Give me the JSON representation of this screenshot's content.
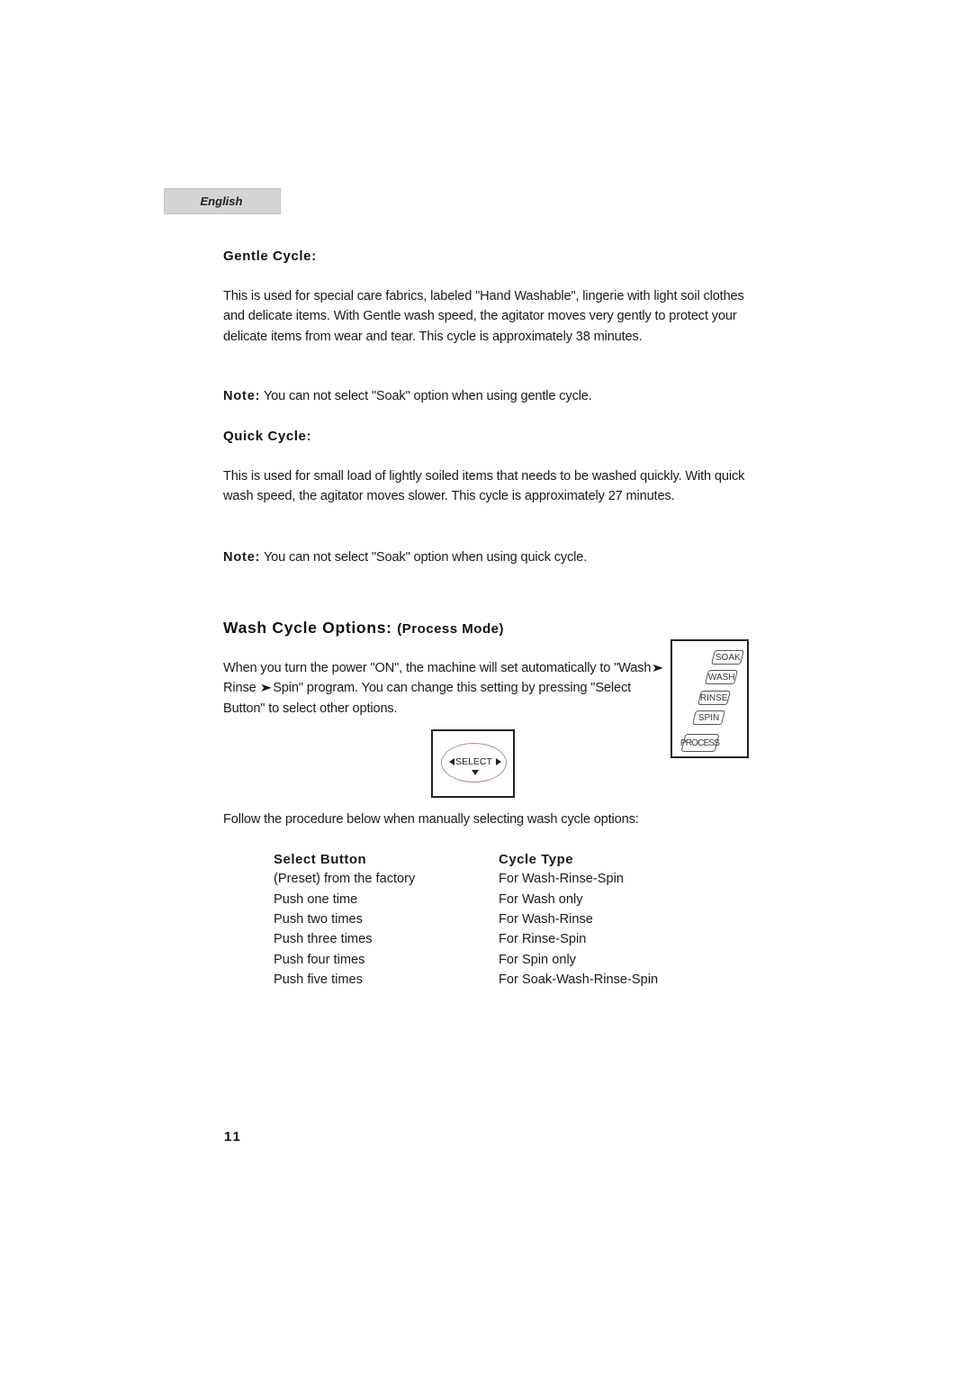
{
  "language_tab": "English",
  "gentle": {
    "heading": "Gentle Cycle:",
    "text": "This is used for special care fabrics, labeled \"Hand Washable\", lingerie with light soil clothes and delicate items. With Gentle wash speed, the agitator moves very gently to protect your delicate items from wear and tear. This cycle is approximately 38 minutes.",
    "note_label": "Note:",
    "note_text": " You can not select \"Soak\" option when using gentle cycle."
  },
  "quick": {
    "heading": "Quick Cycle:",
    "text": "This is used for small load of lightly soiled items that needs to be washed quickly. With quick wash speed, the agitator moves slower. This cycle is approximately 27 minutes.",
    "note_label": "Note:",
    "note_text": " You can not select \"Soak\" option when using quick cycle."
  },
  "wash_options": {
    "heading": "Wash Cycle Options: ",
    "heading_paren": "(Process Mode)",
    "text_part1": "When you turn the power \"ON\", the machine will set automatically to \"Wash",
    "text_part2": "Rinse",
    "text_part3": "Spin\" program. You can change this setting by pressing \"Select Button\" to select other options.",
    "arrow_glyph": "➤",
    "process_panel": {
      "buttons": [
        "SOAK",
        "WASH",
        "RINSE",
        "SPIN",
        "PROCESS"
      ]
    },
    "select_button": {
      "label": "SELECT"
    },
    "follow_text": "Follow the procedure below when manually selecting wash cycle options:"
  },
  "table": {
    "headers": [
      "Select Button",
      "Cycle Type"
    ],
    "rows": [
      [
        "(Preset) from the factory",
        "For Wash-Rinse-Spin"
      ],
      [
        "Push one time",
        "For Wash only"
      ],
      [
        "Push two times",
        "For Wash-Rinse"
      ],
      [
        "Push three times",
        "For Rinse-Spin"
      ],
      [
        "Push four times",
        "For Spin only"
      ],
      [
        "Push five times",
        "For Soak-Wash-Rinse-Spin"
      ]
    ]
  },
  "page_number": "11"
}
